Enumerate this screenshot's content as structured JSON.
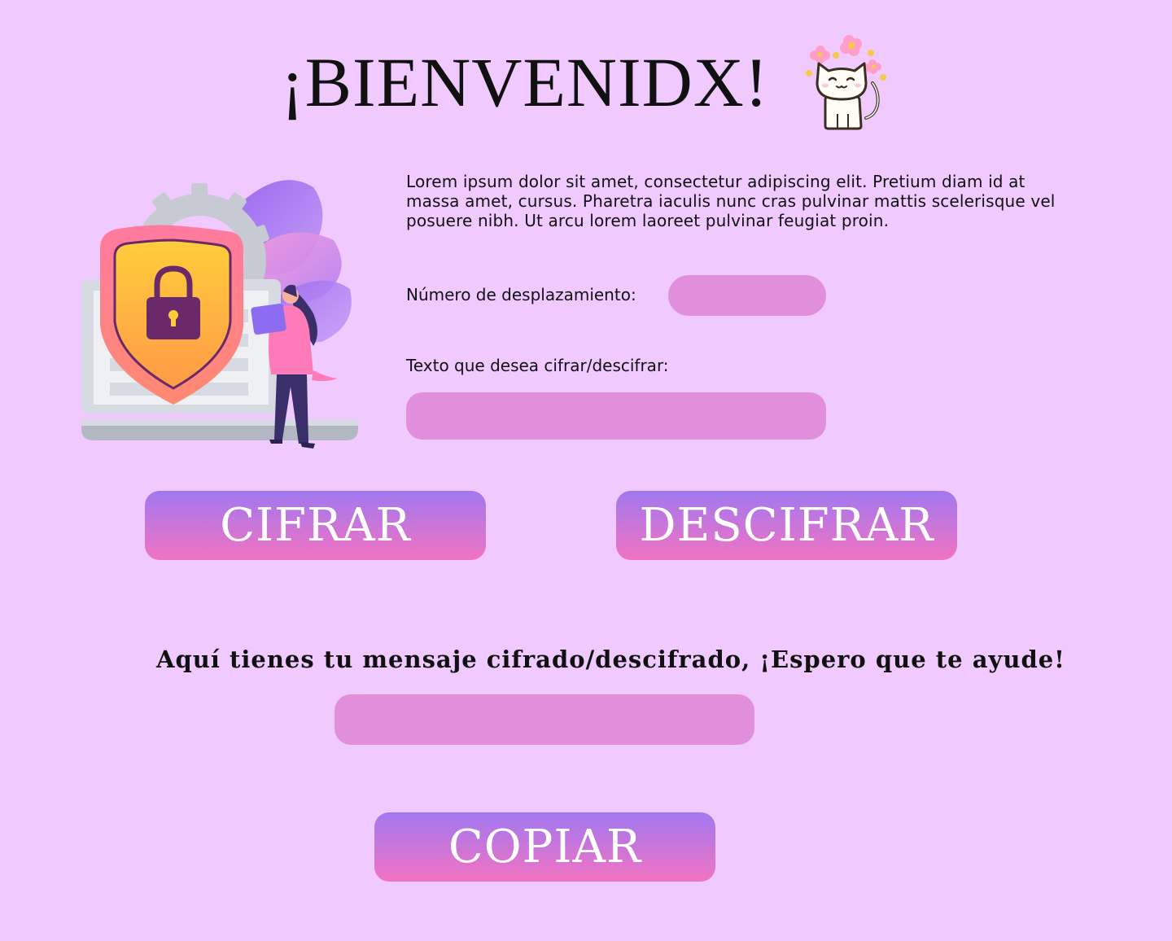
{
  "header": {
    "title": "¡BIENVENIDX!"
  },
  "intro": {
    "text": "Lorem ipsum dolor sit amet, consectetur adipiscing elit. Pretium diam id at massa amet, cursus. Pharetra iaculis nunc cras pulvinar mattis scelerisque vel posuere nibh. Ut arcu lorem laoreet pulvinar feugiat proin."
  },
  "form": {
    "shift_label": "Número de desplazamiento:",
    "shift_value": "",
    "text_label": "Texto que desea cifrar/descifrar:",
    "text_value": ""
  },
  "actions": {
    "encrypt_label": "CIFRAR",
    "decrypt_label": "DESCIFRAR",
    "copy_label": "COPIAR"
  },
  "result": {
    "label": "Aquí tienes tu mensaje cifrado/descifrado, ¡Espero que te ayude!",
    "value": ""
  },
  "colors": {
    "background": "#f0caff",
    "field": "#e18fdc",
    "button_top": "#a178f0",
    "button_bottom": "#f273c2"
  },
  "icons": {
    "header": "cat-with-flowers-icon",
    "hero": "security-shield-illustration"
  }
}
